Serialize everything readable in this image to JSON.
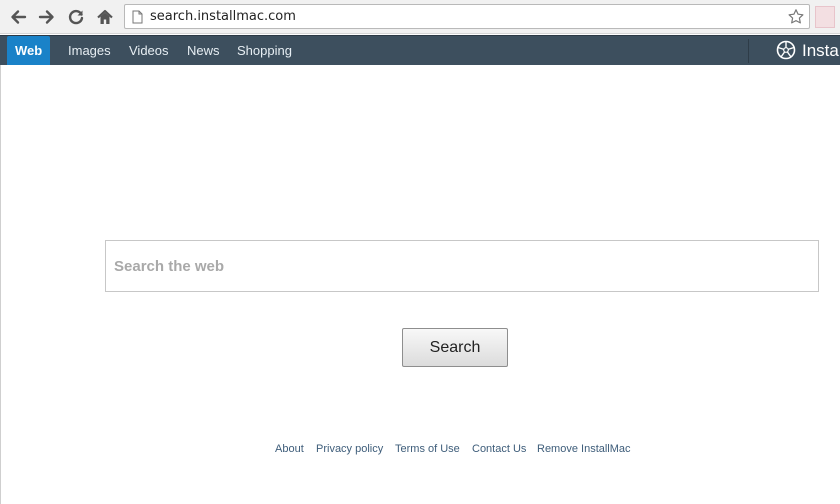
{
  "browser": {
    "url": "search.installmac.com",
    "icons": [
      "back-arrow-icon",
      "forward-arrow-icon",
      "reload-icon",
      "home-icon",
      "page-icon",
      "star-icon",
      "extension-icon"
    ]
  },
  "navbar": {
    "items": [
      {
        "label": "Web",
        "active": true
      },
      {
        "label": "Images"
      },
      {
        "label": "Videos"
      },
      {
        "label": "News"
      },
      {
        "label": "Shopping"
      }
    ],
    "brand": "InstallMac",
    "brand_visible": "Insta",
    "colors": {
      "bar": "#3d4f5e",
      "active": "#1a82c8"
    }
  },
  "search": {
    "placeholder": "Search the web",
    "button_label": "Search"
  },
  "footer": {
    "links": [
      "About",
      "Privacy policy",
      "Terms of Use",
      "Contact Us",
      "Remove InstallMac"
    ]
  }
}
